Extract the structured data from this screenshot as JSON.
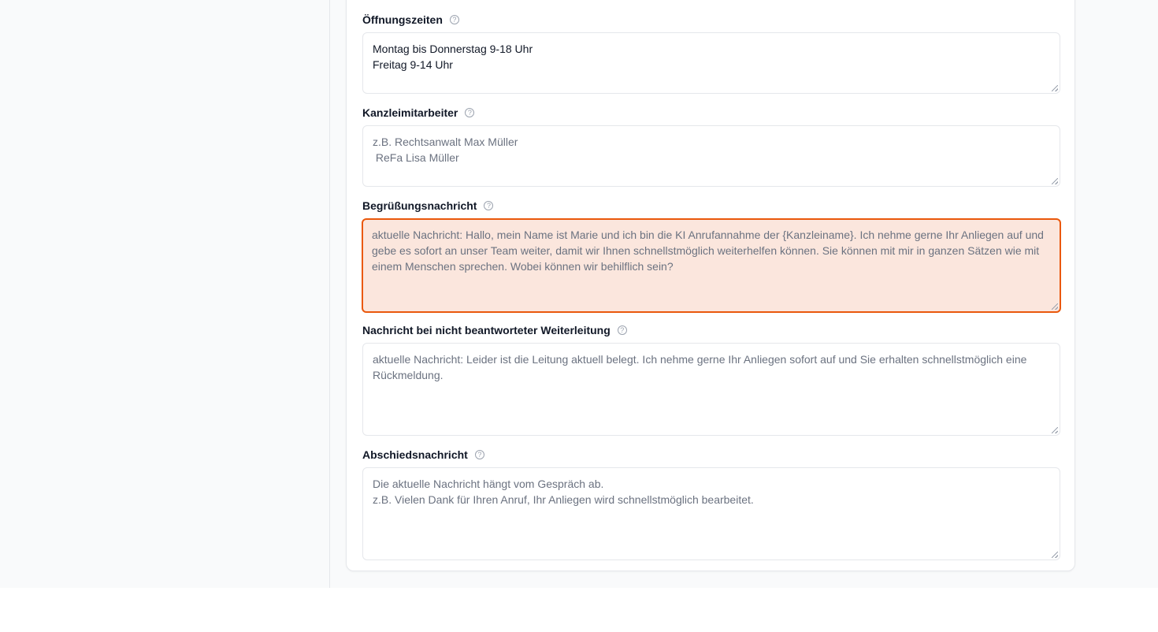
{
  "form": {
    "help_icon_glyph": "?",
    "fields": [
      {
        "label": "Öffnungszeiten",
        "value": "Montag bis Donnerstag 9-18 Uhr\nFreitag 9-14 Uhr",
        "placeholder": ""
      },
      {
        "label": "Kanzleimitarbeiter",
        "value": "",
        "placeholder": "z.B. Rechtsanwalt Max Müller\n ReFa Lisa Müller"
      },
      {
        "label": "Begrüßungsnachricht",
        "value": "",
        "placeholder": "aktuelle Nachricht: Hallo, mein Name ist Marie und ich bin die KI Anrufannahme der {Kanzleiname}. Ich nehme gerne Ihr Anliegen auf und gebe es sofort an unser Team weiter, damit wir Ihnen schnellstmöglich weiterhelfen können. Sie können mit mir in ganzen Sätzen wie mit einem Menschen sprechen. Wobei können wir behilflich sein?",
        "state": "focused"
      },
      {
        "label": "Nachricht bei nicht beantworteter Weiterleitung",
        "value": "",
        "placeholder": "aktuelle Nachricht: Leider ist die Leitung aktuell belegt. Ich nehme gerne Ihr Anliegen sofort auf und Sie erhalten schnellstmöglich eine Rückmeldung."
      },
      {
        "label": "Abschiedsnachricht",
        "value": "",
        "placeholder": "Die aktuelle Nachricht hängt vom Gespräch ab.\nz.B. Vielen Dank für Ihren Anruf, Ihr Anliegen wird schnellstmöglich bearbeitet."
      }
    ]
  },
  "colors": {
    "focus_border": "#ea580c",
    "focus_background": "#fbe6dd",
    "border": "#e5e7eb",
    "placeholder": "#6b7280",
    "text": "#111827"
  }
}
